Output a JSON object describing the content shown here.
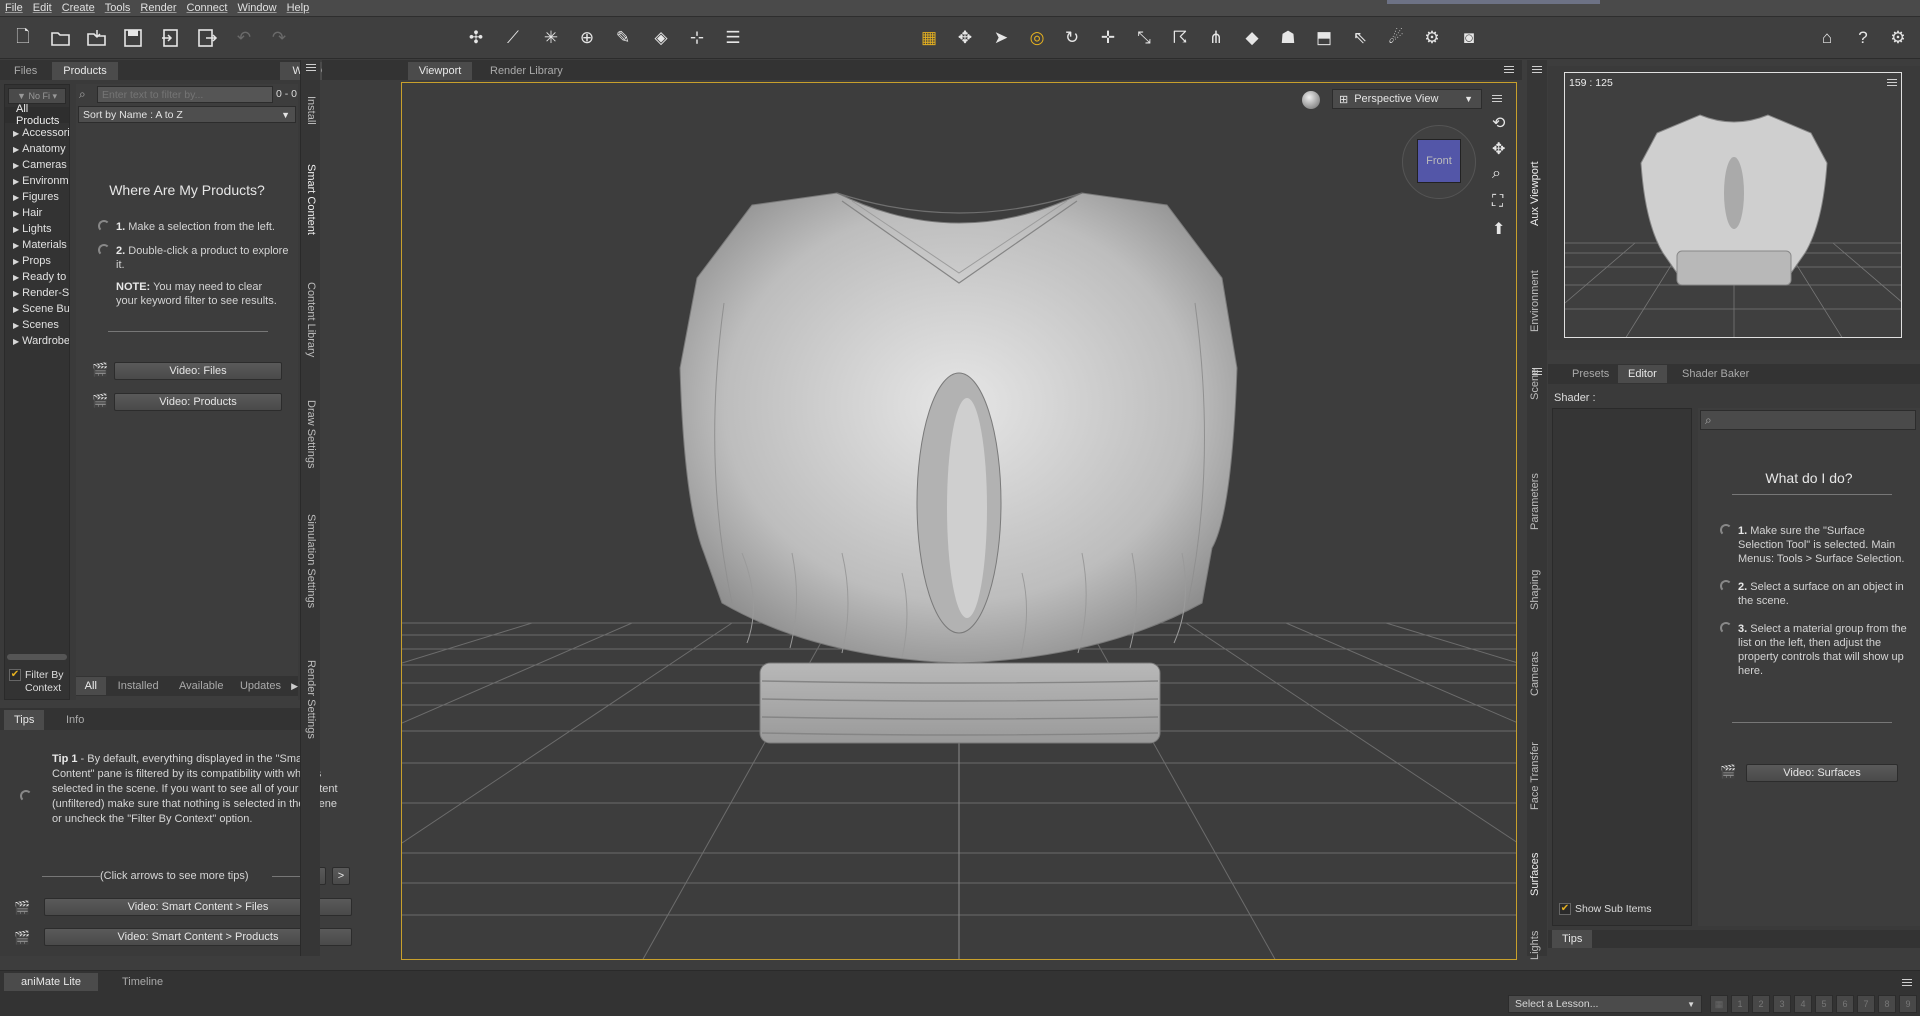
{
  "menu": [
    "File",
    "Edit",
    "Create",
    "Tools",
    "Render",
    "Connect",
    "Window",
    "Help"
  ],
  "toolbar": {
    "icons": [
      "new-file-icon",
      "open-icon",
      "merge-icon",
      "save-icon",
      "import-icon",
      "export-icon",
      "undo-icon",
      "redo-icon",
      "figure-setup-icon",
      "joint-editor-icon",
      "bone-icon",
      "geometry-tool-icon",
      "spot-render-icon",
      "morph-icon",
      "transfer-icon",
      "menu-lines-icon",
      "universal-tool-icon",
      "node-select-icon",
      "pointer-icon",
      "active-pose-icon",
      "rotate-icon",
      "translate-icon",
      "scale-icon",
      "surface-tool-icon",
      "geometry-editor-icon",
      "surface-selection-icon",
      "figure-icon",
      "camera-icon",
      "selection-icon",
      "node-weight-icon",
      "camera2-icon",
      "render-camera-icon",
      "home-icon",
      "help-icon"
    ]
  },
  "left_panel": {
    "tabs": [
      "Files",
      "Products"
    ],
    "active_tab": "Products",
    "work_offline": "Work Offline",
    "filter_placeholder": "Enter text to filter by...",
    "filter_count": "0 - 0",
    "sort_label": "Sort by Name : A to Z",
    "all_products": "All Products",
    "categories": [
      "Accessories",
      "Anatomy",
      "Cameras",
      "Environments",
      "Figures",
      "Hair",
      "Lights",
      "Materials",
      "Props",
      "Ready to Render",
      "Render-Settings",
      "Scene Builder",
      "Scenes",
      "Wardrobe"
    ],
    "where_title": "Where Are My Products?",
    "step1_num": "1.",
    "step1": "Make a selection from the left.",
    "step2_num": "2.",
    "step2": "Double-click a product to explore it.",
    "note_label": "NOTE:",
    "note_text": "You may need to clear your keyword filter to see results.",
    "video_files": "Video: Files",
    "video_products": "Video: Products",
    "filter_by_context": "Filter By Context",
    "bottom_tabs": [
      "All",
      "Installed",
      "Available",
      "Updates"
    ]
  },
  "left_vtabs": [
    "Install",
    "Smart Content",
    "Content Library",
    "Draw Settings",
    "Simulation Settings",
    "Render Settings"
  ],
  "tips_panel": {
    "tabs": [
      "Tips",
      "Info"
    ],
    "tip_label": "Tip 1",
    "tip_text": " - By default, everything displayed in the \"Smart Content\" pane is filtered by its compatibility with what is selected in the scene. If you want to see all of your content (unfiltered) make sure that nothing is selected in the scene or uncheck the \"Filter By Context\" option.",
    "arrows_hint": "(Click arrows to see more tips)",
    "prev": "<",
    "next": ">",
    "video1": "Video: Smart Content > Files",
    "video2": "Video: Smart Content > Products"
  },
  "viewport": {
    "tabs": [
      "Viewport",
      "Render Library"
    ],
    "active_tab": "Viewport",
    "view_mode": "Perspective View",
    "cube_label": "Front"
  },
  "right_vtabs_top": [
    "Aux Viewport",
    "Environment",
    "Scene"
  ],
  "right_vtabs_bottom": [
    "Parameters",
    "Shaping",
    "Cameras",
    "Face Transfer",
    "Surfaces",
    "Lights"
  ],
  "aux_viewport": {
    "size_label": "159 : 125"
  },
  "surfaces": {
    "tabs": [
      "Presets",
      "Editor",
      "Shader Baker"
    ],
    "active_tab": "Editor",
    "shader_label": "Shader :",
    "what_title": "What do I do?",
    "step1_num": "1.",
    "step1": "Make sure the \"Surface Selection Tool\" is selected. Main Menus: Tools > Surface Selection.",
    "step2_num": "2.",
    "step2": "Select a surface on an object in the scene.",
    "step3_num": "3.",
    "step3": "Select a material group from the list on the left, then adjust the property controls that will show up here.",
    "video_surfaces": "Video: Surfaces",
    "show_sub_items": "Show Sub Items",
    "bottom_tab": "Tips"
  },
  "bottom": {
    "tabs": [
      "aniMate Lite",
      "Timeline"
    ],
    "lesson_placeholder": "Select a Lesson...",
    "lesson_steps": [
      "1",
      "2",
      "3",
      "4",
      "5",
      "6",
      "7",
      "8",
      "9"
    ]
  },
  "colors": {
    "accent": "#e4b020",
    "viewport_border": "#c8a02c",
    "cube_face": "#5356a8"
  }
}
